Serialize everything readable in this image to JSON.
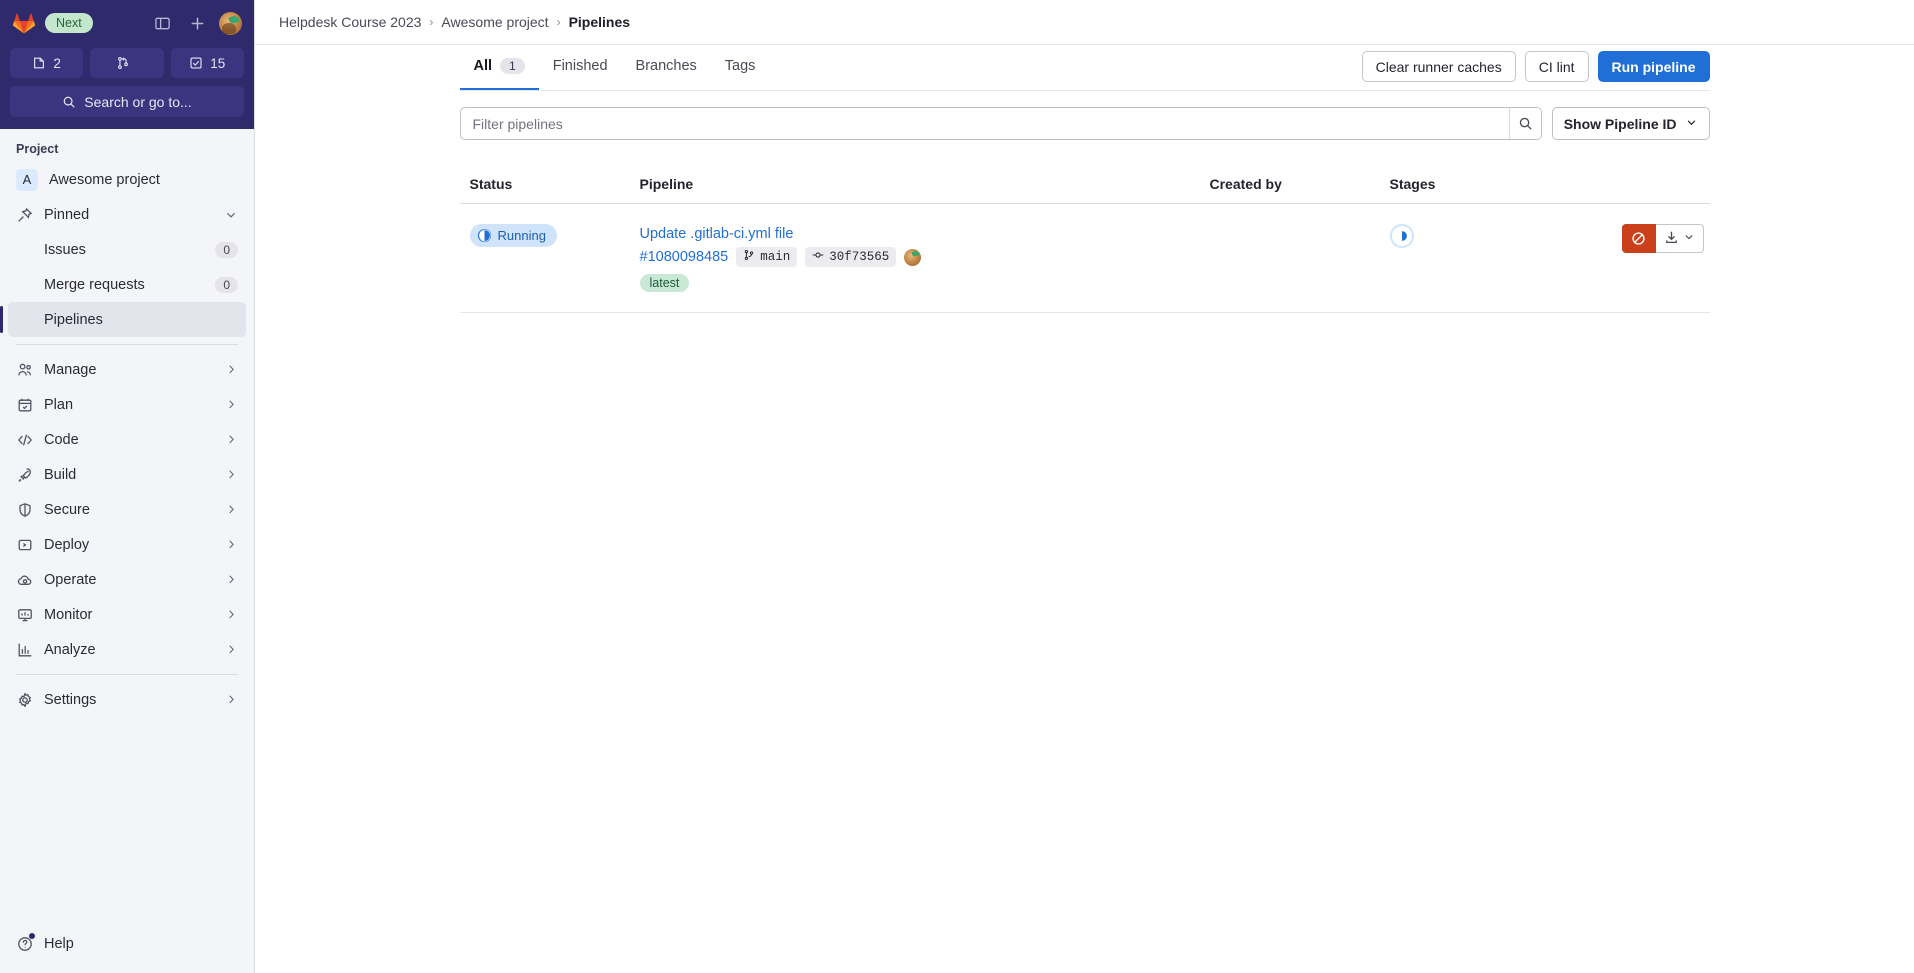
{
  "sidebar": {
    "brand": {
      "logo": "gitlab-logo",
      "pill_label": "Next"
    },
    "header_icons": [
      {
        "name": "toggle-sidebar-icon"
      },
      {
        "name": "plus-icon"
      },
      {
        "name": "user-avatar"
      }
    ],
    "counters": [
      {
        "name": "issues-counter",
        "icon": "merge-request-open-icon",
        "value": "2"
      },
      {
        "name": "merge-requests-counter",
        "icon": "merge-request-icon",
        "value": ""
      },
      {
        "name": "todos-counter",
        "icon": "todo-check-icon",
        "value": "15"
      }
    ],
    "search": {
      "label": "Search or go to...",
      "icon": "search-icon"
    },
    "section_title": "Project",
    "project": {
      "initial": "A",
      "label": "Awesome project"
    },
    "pinned": {
      "label": "Pinned",
      "icon": "pin-icon",
      "chevron": "chevron-down-icon"
    },
    "pinned_items": [
      {
        "label": "Issues",
        "count": "0"
      },
      {
        "label": "Merge requests",
        "count": "0"
      },
      {
        "label": "Pipelines",
        "count": "",
        "active": true
      }
    ],
    "nav": [
      {
        "label": "Manage",
        "icon": "users-icon"
      },
      {
        "label": "Plan",
        "icon": "calendar-icon"
      },
      {
        "label": "Code",
        "icon": "code-icon"
      },
      {
        "label": "Build",
        "icon": "rocket-icon"
      },
      {
        "label": "Secure",
        "icon": "shield-icon"
      },
      {
        "label": "Deploy",
        "icon": "deploy-icon"
      },
      {
        "label": "Operate",
        "icon": "cloud-gear-icon"
      },
      {
        "label": "Monitor",
        "icon": "monitor-icon"
      },
      {
        "label": "Analyze",
        "icon": "chart-icon"
      }
    ],
    "settings": {
      "label": "Settings",
      "icon": "gear-icon"
    },
    "help": {
      "label": "Help",
      "icon": "question-circle-icon",
      "has_notification_dot": true
    }
  },
  "breadcrumb": {
    "items": [
      {
        "label": "Helpdesk Course 2023",
        "current": false
      },
      {
        "label": "Awesome project",
        "current": false
      },
      {
        "label": "Pipelines",
        "current": true
      }
    ],
    "separator": "›"
  },
  "tabs": [
    {
      "label": "All",
      "badge": "1",
      "active": true
    },
    {
      "label": "Finished",
      "badge": "",
      "active": false
    },
    {
      "label": "Branches",
      "badge": "",
      "active": false
    },
    {
      "label": "Tags",
      "badge": "",
      "active": false
    }
  ],
  "actions": {
    "clear_runner_caches": "Clear runner caches",
    "ci_lint": "CI lint",
    "run_pipeline": "Run pipeline"
  },
  "filter": {
    "placeholder": "Filter pipelines",
    "value": "",
    "search_icon": "search-icon",
    "select_label": "Show Pipeline ID",
    "select_chevron": "chevron-down-icon"
  },
  "table": {
    "columns": [
      "Status",
      "Pipeline",
      "Created by",
      "Stages"
    ],
    "rows": [
      {
        "status": {
          "label": "Running",
          "icon": "running-spinner-icon",
          "color": "#1f5fb0"
        },
        "pipeline": {
          "title": "Update .gitlab-ci.yml file",
          "id": "#1080098485",
          "branch": "main",
          "branch_icon": "branch-icon",
          "commit": "30f73565",
          "commit_icon": "commit-icon",
          "tag": "latest"
        },
        "created_by": {
          "avatar": "user-avatar"
        },
        "stages": [
          {
            "name": "stage-status-running",
            "icon": "running-spinner-icon"
          }
        ],
        "row_actions": {
          "cancel": {
            "name": "cancel-pipeline-button",
            "icon": "cancel-icon",
            "color": "#c9401b"
          },
          "download": {
            "name": "download-artifacts-button",
            "icon": "download-icon"
          },
          "chevron": "chevron-down-icon"
        }
      }
    ]
  }
}
